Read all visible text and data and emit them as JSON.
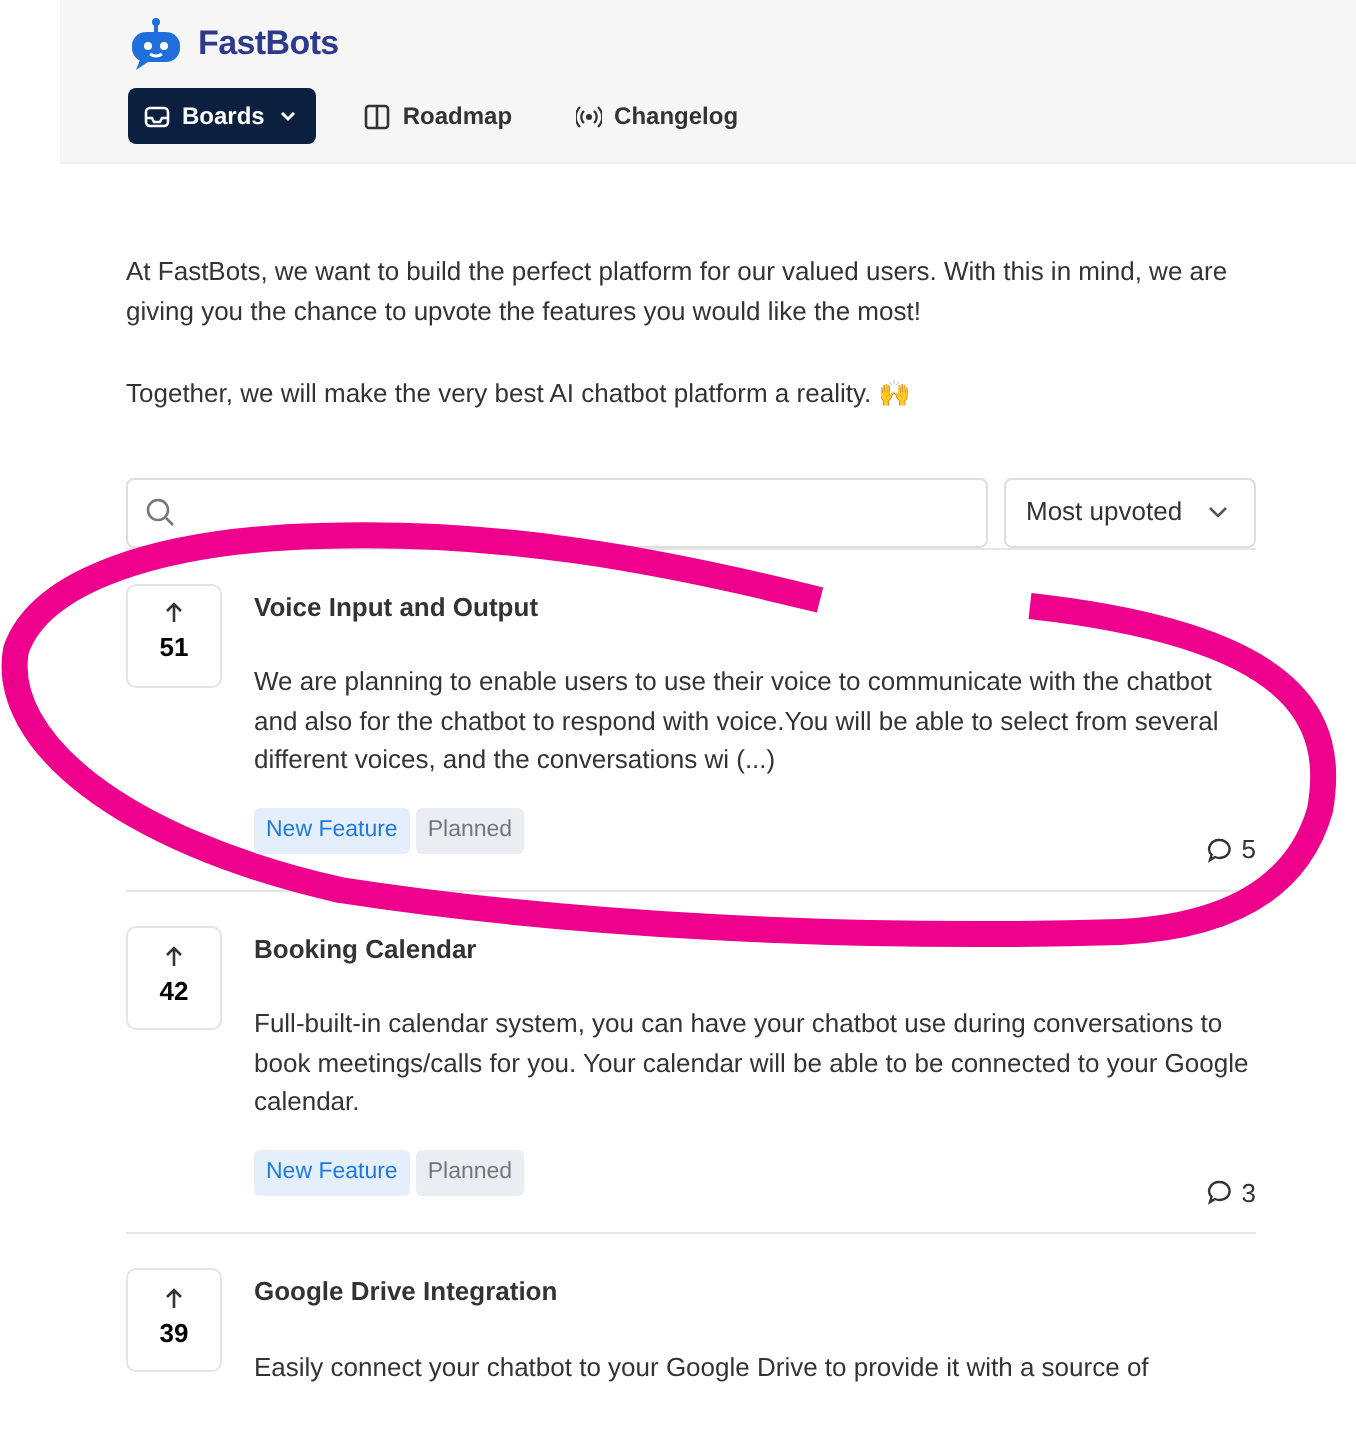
{
  "logo": {
    "text": "FastBots"
  },
  "nav": [
    {
      "label": "Boards",
      "kind": "dropdown",
      "selected": true
    },
    {
      "label": "Roadmap",
      "kind": "roadmap",
      "selected": false
    },
    {
      "label": "Changelog",
      "kind": "changelog",
      "selected": false
    }
  ],
  "intro": [
    "At FastBots, we want to build the perfect platform for our valued users. With this in mind, we are giving you the chance to upvote the features you would like the most!",
    "Together, we will make the very best AI chatbot platform a reality. 🙌"
  ],
  "sort": {
    "value": "Most upvoted"
  },
  "posts": [
    {
      "title": "Voice Input and Output",
      "votes": "51",
      "body": "We are planning to enable users to use their voice to communicate with the chatbot and also for the chatbot to respond with voice.You will be able to select from several different voices, and the conversations wi (...)",
      "tags": [
        {
          "label": "New Feature",
          "kind": "type"
        },
        {
          "label": "Planned",
          "kind": "status"
        }
      ],
      "comments": "5"
    },
    {
      "title": "Booking Calendar",
      "votes": "42",
      "body": "Full-built-in calendar system, you can have your chatbot use during conversations to book meetings/calls for you. Your calendar will be able to be connected to your Google calendar.",
      "tags": [
        {
          "label": "New Feature",
          "kind": "type"
        },
        {
          "label": "Planned",
          "kind": "status"
        }
      ],
      "comments": "3"
    },
    {
      "title": "Google Drive Integration",
      "votes": "39",
      "body": "Easily connect your chatbot to your Google Drive to provide it with a source of"
    }
  ],
  "annotation": {
    "kind": "scribble"
  }
}
